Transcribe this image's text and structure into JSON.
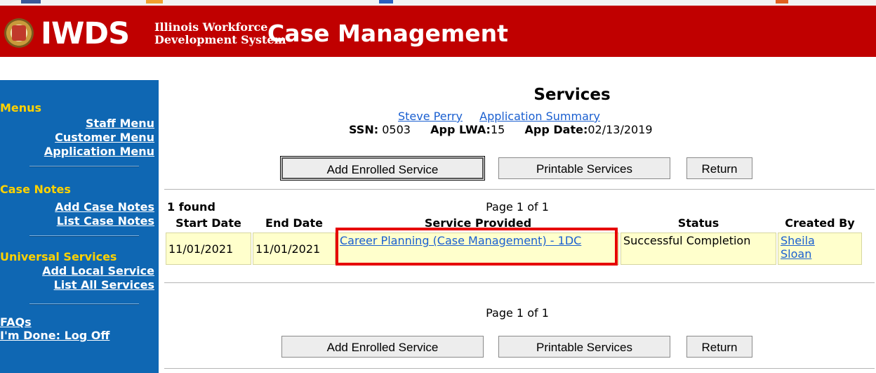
{
  "banner": {
    "logo_text": "IWDS",
    "subtitle_line1": "Illinois Workforce",
    "subtitle_line2": "Development System",
    "app_name": "Case Management"
  },
  "sidebar": {
    "menus_heading": "Menus",
    "staff_menu": "Staff Menu",
    "customer_menu": "Customer Menu",
    "application_menu": "Application Menu",
    "case_notes_heading": "Case Notes",
    "add_case_notes": "Add Case Notes",
    "list_case_notes": "List Case Notes",
    "universal_heading": "Universal Services",
    "add_local_service": "Add Local Service",
    "list_all_services": "List All Services",
    "faqs": "FAQs",
    "log_off": "I'm Done: Log Off"
  },
  "page": {
    "title": "Services",
    "customer_name": "Steve Perry",
    "app_summary_link": "Application Summary",
    "ssn_label": "SSN:",
    "ssn_value": "0503",
    "lwa_label": "App LWA:",
    "lwa_value": "15",
    "date_label": "App Date:",
    "date_value": "02/13/2019"
  },
  "buttons": {
    "add_enrolled": "Add Enrolled Service",
    "printable": "Printable Services",
    "return": "Return"
  },
  "results": {
    "found": "1 found",
    "page_info": "Page 1 of 1"
  },
  "table": {
    "headers": [
      "Start Date",
      "End Date",
      "Service Provided",
      "Status",
      "Created By"
    ],
    "rows": [
      {
        "start": "11/01/2021",
        "end": "11/01/2021",
        "service": "Career Planning (Case Management) - 1DC",
        "status": "Successful Completion",
        "created_by_first": "Sheila",
        "created_by_last": "Sloan"
      }
    ]
  },
  "colors": {
    "banner": "#c00000",
    "sidebar": "#0f67b3",
    "sidebar_heading": "#ffd200",
    "row_bg": "#ffffcc",
    "link": "#1a5fd0",
    "highlight": "#e60000"
  }
}
